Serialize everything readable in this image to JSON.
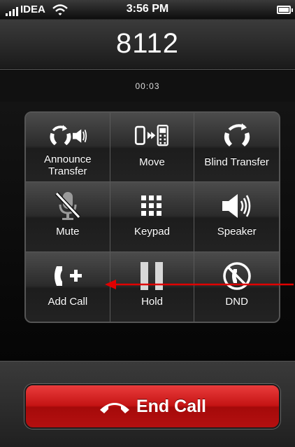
{
  "status_bar": {
    "carrier": "IDEA",
    "time": "3:56 PM",
    "signal_bars": 4,
    "icons": [
      "signal-icon",
      "wifi-icon",
      "battery-icon"
    ]
  },
  "call": {
    "number": "8112",
    "duration": "00:03"
  },
  "buttons": [
    {
      "id": "announce-transfer",
      "label_lines": [
        "Announce",
        "Transfer"
      ],
      "icon": "announce-transfer-icon"
    },
    {
      "id": "move",
      "label": "Move",
      "icon": "move-to-phone-icon"
    },
    {
      "id": "blind-transfer",
      "label": "Blind Transfer",
      "icon": "blind-transfer-icon"
    },
    {
      "id": "mute",
      "label": "Mute",
      "icon": "muted-microphone-icon"
    },
    {
      "id": "keypad",
      "label": "Keypad",
      "icon": "keypad-icon"
    },
    {
      "id": "speaker",
      "label": "Speaker",
      "icon": "speaker-icon"
    },
    {
      "id": "add-call",
      "label": "Add Call",
      "icon": "add-call-icon"
    },
    {
      "id": "hold",
      "label": "Hold",
      "icon": "pause-icon"
    },
    {
      "id": "dnd",
      "label": "DND",
      "icon": "do-not-disturb-icon"
    }
  ],
  "end_call": {
    "label": "End Call",
    "icon": "handset-down-icon"
  },
  "annotation": {
    "target": "add-call",
    "color": "#e00000"
  },
  "colors": {
    "end_call_red": "#c51414",
    "background": "#000000"
  }
}
